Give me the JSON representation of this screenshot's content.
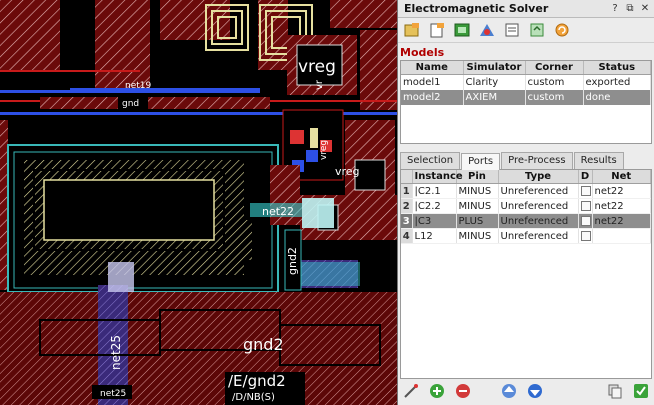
{
  "window": {
    "title": "Electromagnetic Solver"
  },
  "toolbar": {
    "icons": [
      "new-model-icon",
      "add-model-icon",
      "simulate-icon",
      "port-setup-icon",
      "settings-icon",
      "refresh-icon",
      "undo-icon"
    ]
  },
  "models": {
    "section_label": "Models",
    "columns": [
      "Name",
      "Simulator",
      "Corner",
      "Status"
    ],
    "rows": [
      {
        "name": "model1",
        "simulator": "Clarity",
        "corner": "custom",
        "status": "exported"
      },
      {
        "name": "model2",
        "simulator": "AXIEM",
        "corner": "custom",
        "status": "done"
      }
    ],
    "selected_row": 1
  },
  "tabs": [
    "Selection",
    "Ports",
    "Pre-Process",
    "Results"
  ],
  "active_tab": "Ports",
  "ports": {
    "columns": [
      "Instance",
      "Pin",
      "Type",
      "D",
      "Net"
    ],
    "rows": [
      {
        "n": "1",
        "instance": "|C2.1",
        "pin": "MINUS",
        "type": "Unreferenced",
        "net": "net22"
      },
      {
        "n": "2",
        "instance": "|C2.2",
        "pin": "MINUS",
        "type": "Unreferenced",
        "net": "net22"
      },
      {
        "n": "3",
        "instance": "|C3",
        "pin": "PLUS",
        "type": "Unreferenced",
        "net": "net22"
      },
      {
        "n": "4",
        "instance": "L12",
        "pin": "MINUS",
        "type": "Unreferenced",
        "net": ""
      }
    ],
    "selected_row": 2
  },
  "layout_labels": {
    "net19": "net19",
    "gnd_top": "gnd",
    "vreg_big": "vreg",
    "vreg_small": "vreg",
    "vreg_vertical": "vreg",
    "net22": "net22",
    "gnd2_vertical": "gnd2",
    "gnd2": "gnd2",
    "net25_vertical": "net25",
    "net25": "net25",
    "e_gnd2": "/E/gnd2",
    "e_gnd2_sub": "/D/NB(S)",
    "vr_small": "vr",
    "seg_label": "gnd"
  },
  "colors": {
    "accent_red": "#b00000",
    "selection_gray": "#8e8e8e",
    "highlight_cyan": "#39d3d3"
  }
}
